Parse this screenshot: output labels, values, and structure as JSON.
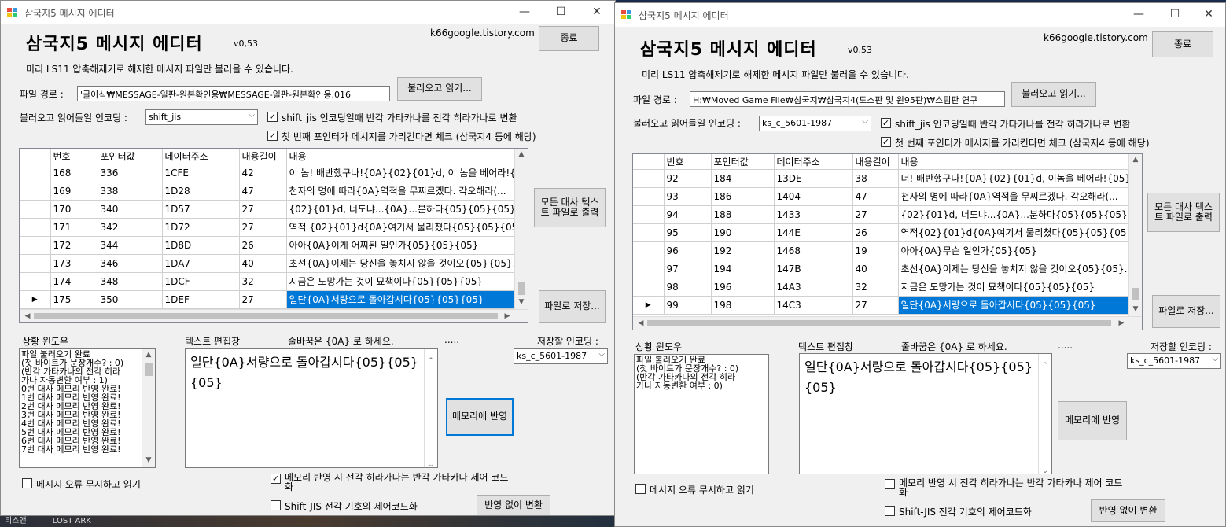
{
  "desktop": {
    "taskbar_items": [
      "티스앤",
      "LOST ARK"
    ]
  },
  "windows": [
    {
      "window_title": "삼국지5 메시지 에디터",
      "app_title": "삼국지5 메시지 에디터",
      "version": "v0,53",
      "site": "k66google.tistory.com",
      "close_btn": "종료",
      "notice": "미리 LS11 압축해제기로 해제한 메시지 파일만 불러올 수 있습니다.",
      "file_path_label": "파일 경로 :",
      "file_path_value": "'글이식₩MESSAGE-일판-원본확인용₩MESSAGE-일판-원본확인용.016",
      "load_btn": "불러오고 읽기...",
      "encoding_label": "불러오고 읽어들일 인코딩 :",
      "encoding_value": "shift_jis",
      "chk_kana": {
        "label": "shift_jis 인코딩일때 반각 가타카나를 전각 히라가나로 변환",
        "checked": true
      },
      "chk_pointer": {
        "label": "첫 번째 포인터가 메시지를 가리킨다면 체크 (삼국지4 등에 해당)",
        "checked": true
      },
      "columns": [
        "번호",
        "포인터값",
        "데이터주소",
        "내용길이",
        "내용"
      ],
      "rows": [
        [
          "168",
          "336",
          "1CFE",
          "42",
          "이 놈! 배반했구나!{0A}{02}{01}d, 이 놈을 베어라!{..."
        ],
        [
          "169",
          "338",
          "1D28",
          "47",
          "천자의 명에 따라{0A}역적을 무찌르겠다. 각오해라(..."
        ],
        [
          "170",
          "340",
          "1D57",
          "27",
          "{02}{01}d, 너도냐...{0A}...분하다{05}{05}{05}"
        ],
        [
          "171",
          "342",
          "1D72",
          "27",
          "역적 {02}{01}d{0A}여기서 물리쳤다{05}{05}{05}"
        ],
        [
          "172",
          "344",
          "1D8D",
          "26",
          "아아{0A}이게 어찌된 일인가{05}{05}{05}"
        ],
        [
          "173",
          "346",
          "1DA7",
          "40",
          "초선{0A}이제는 당신을 놓치지 않을 것이오{05}{05}..."
        ],
        [
          "174",
          "348",
          "1DCF",
          "32",
          "지금은 도망가는 것이 묘책이다{05}{05}{05}"
        ],
        [
          "175",
          "350",
          "1DEF",
          "27",
          "일단{0A}서량으로 돌아갑시다{05}{05}{05}"
        ]
      ],
      "selected_row": 7,
      "export_btn": "모든 대사 텍스트 파일로 출력",
      "save_file_btn": "파일로 저장...",
      "status_label": "상황 윈도우",
      "status_lines": [
        "파일 불러오기 완료",
        "(첫 바이트가 문장개수? : 0)",
        "(반각 가타카나의 전각 히라",
        "가나 자동변환 여부 : 1)",
        "0번 대사 메모리 반영 완료!",
        "1번 대사 메모리 반영 완료!",
        "2번 대사 메모리 반영 완료!",
        "3번 대사 메모리 반영 완료!",
        "4번 대사 메모리 반영 완료!",
        "5번 대사 메모리 반영 완료!",
        "6번 대사 메모리 반영 완료!",
        "7번 대사 메모리 반영 완료!"
      ],
      "editor_label": "텍스트 편집창",
      "newline_hint": "줄바꿈은 {0A} 로 하세요.",
      "dots": ".....",
      "save_enc_label": "저장할 인코딩 :",
      "save_enc_value": "ks_c_5601-1987",
      "editor_text": "일단{0A}서량으로 돌아갑시다{05}{05}{05}",
      "apply_btn": "메모리에 반영",
      "chk_ignore": {
        "label": "메시지 오류 무시하고 읽기",
        "checked": false
      },
      "chk_hira": {
        "label": "메모리 반영 시 전각 히라가나는 반각 가타카나 제어 코드화",
        "checked": true
      },
      "chk_sjis": {
        "label": "Shift-JIS 전각 기호의 제어코드화",
        "checked": false
      },
      "convert_btn": "반영 없이 변환"
    },
    {
      "window_title": "삼국지5 메시지 에디터",
      "app_title": "삼국지5 메시지 에디터",
      "version": "v0,53",
      "site": "k66google.tistory.com",
      "close_btn": "종료",
      "notice": "미리 LS11 압축해제기로 해제한 메시지 파일만 불러올 수 있습니다.",
      "file_path_label": "파일 경로 :",
      "file_path_value": "H:₩Moved Game File₩삼국지₩삼국지4(도스판 및 윈95판)₩스팀판 연구",
      "load_btn": "불러오고 읽기...",
      "encoding_label": "불러오고 읽어들일 인코딩 :",
      "encoding_value": "ks_c_5601-1987",
      "chk_kana": {
        "label": "shift_jis 인코딩일때 반각 가타카나를 전각 히라가나로 변환",
        "checked": true
      },
      "chk_pointer": {
        "label": "첫 번째 포인터가 메시지를 가리킨다면 체크 (삼국지4 등에 해당)",
        "checked": true
      },
      "columns": [
        "번호",
        "포인터값",
        "데이터주소",
        "내용길이",
        "내용"
      ],
      "rows": [
        [
          "92",
          "184",
          "13DE",
          "38",
          "너! 배반했구나!{0A}{02}{01}d, 이놈을 베어라!{05},..."
        ],
        [
          "93",
          "186",
          "1404",
          "47",
          "천자의 명에 따라{0A}역적을 무찌르겠다. 각오해라(..."
        ],
        [
          "94",
          "188",
          "1433",
          "27",
          "{02}{01}d, 너도냐...{0A}...분하다{05}{05}{05}"
        ],
        [
          "95",
          "190",
          "144E",
          "26",
          "역적{02}{01}d{0A}여기서 물리쳤다{05}{05}{05}"
        ],
        [
          "96",
          "192",
          "1468",
          "19",
          "아아{0A}무슨 일인가{05}{05}"
        ],
        [
          "97",
          "194",
          "147B",
          "40",
          "초선{0A}이제는 당신을 놓치지 않을 것이오{05}{05}..."
        ],
        [
          "98",
          "196",
          "14A3",
          "32",
          "지금은 도망가는 것이 묘책이다{05}{05}{05}"
        ],
        [
          "99",
          "198",
          "14C3",
          "27",
          "일단{0A}서량으로 돌아갑시다{05}{05}{05}"
        ]
      ],
      "selected_row": 7,
      "export_btn": "모든 대사 텍스트 파일로 출력",
      "save_file_btn": "파일로 저장...",
      "status_label": "상황 윈도우",
      "status_lines": [
        "파일 불러오기 완료",
        "(첫 바이트가 문장개수? : 0)",
        "(반각 가타카나의 전각 히라",
        "가나 자동변환 여부 : 0)"
      ],
      "editor_label": "텍스트 편집창",
      "newline_hint": "줄바꿈은 {0A} 로 하세요.",
      "dots": ".....",
      "save_enc_label": "저장할 인코딩 :",
      "save_enc_value": "ks_c_5601-1987",
      "editor_text": "일단{0A}서량으로 돌아갑시다{05}{05}{05}",
      "apply_btn": "메모리에 반영",
      "chk_ignore": {
        "label": "메시지 오류 무시하고 읽기",
        "checked": false
      },
      "chk_hira": {
        "label": "메모리 반영 시 전각 히라가나는 반각 가타카나 제어 코드화",
        "checked": false
      },
      "chk_sjis": {
        "label": "Shift-JIS 전각 기호의 제어코드화",
        "checked": false
      },
      "convert_btn": "반영 없이 변환"
    }
  ]
}
